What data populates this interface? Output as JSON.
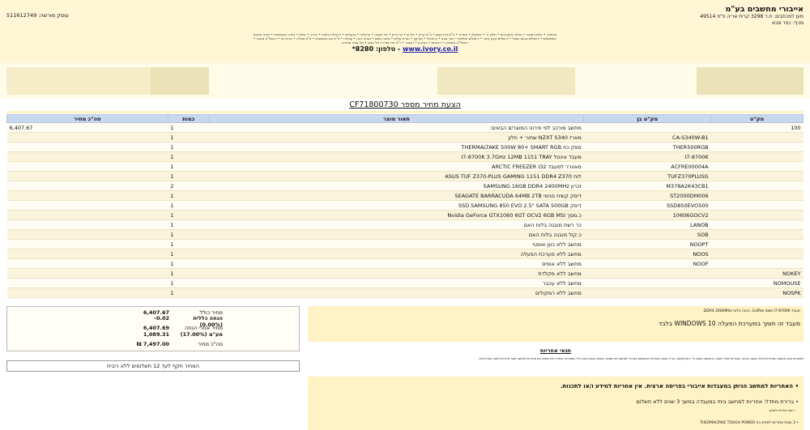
{
  "company": {
    "name": "אייבורי מחשבים בע\"מ",
    "address": "מען למכתבים: ת.ד 3298 קרית אריה פ\"ת 49514",
    "branch": "סניף: כפר סבא"
  },
  "license": "עוסק מורשה: 511612749",
  "ads_text": "סניפים: • אולם תצוגה • אולם התערוכות • חולון ה' • אשקלון • אשדוד • ב\"ש בית נעמן • ב\"ש קריון • בת ים • בני ברק • בני תקווה • הרצליה • גבעתיים • הרצליה פיתוח • חדרה • חולון • חיפה העצמאות • חיפה תנועת המשתמש • ירושלים גבעת שאול • ירושלים קניון ביתר • ירושלים תלפיות • כפר סבא • כרמיאל • מודיעין • נצרת עילית • נתניה מתם • נתניה רבה • עפולה • פ\"ת אם המושבות • פ\"ת סגולה • קרית גת • ראשל\"צ מערב • ראשל\"צ השכונה • רחובות • רמת גן • רעננה • ר\"ש הדרומית • תל אביב • תל אביב ספורט",
  "website": {
    "url": "www.ivory.co.il",
    "phone": "טלפון: 8280*"
  },
  "quote": {
    "title": "הצעת מחיר מספר CF71800730"
  },
  "table": {
    "headers": {
      "item": "מק\"ט",
      "model": "מק\"ט בן",
      "desc": "תאור מוצר",
      "qty": "כמות",
      "total": "סה\"כ מחיר"
    },
    "rows": [
      {
        "item": "100",
        "model": "",
        "desc": "מחשב מורכב לפי פירוט המוצרים הבאים:",
        "qty": "1",
        "total": "6,407.67"
      },
      {
        "item": "",
        "model": "CA-S340W-B1",
        "desc": "מארז NZXT S340 שחור + חלון",
        "qty": "1",
        "total": ""
      },
      {
        "item": "",
        "model": "THER500RGB",
        "desc": "ספק כח THERMALTAKE 500W 80+ SMART RGB",
        "qty": "1",
        "total": ""
      },
      {
        "item": "",
        "model": "I7-8700K",
        "desc": "מעבד אינטל I7-8700K 3.7GHz 12MB 1151 TRAY",
        "qty": "1",
        "total": ""
      },
      {
        "item": "",
        "model": "ACFRE00004A",
        "desc": "מאוורר למעבד ARCTIC FREEZER I32",
        "qty": "1",
        "total": ""
      },
      {
        "item": "",
        "model": "TUFZ370PLUSG",
        "desc": "לוח ASUS TUF Z370-PLUS GAMING 1151 DDR4 Z370",
        "qty": "1",
        "total": ""
      },
      {
        "item": "",
        "model": "M378A2K43CB1",
        "desc": "זכרון SAMSUNG 16GB DDR4 2400MHz",
        "qty": "2",
        "total": ""
      },
      {
        "item": "",
        "model": "ST2000DM006",
        "desc": "דיסק קשיח פנימי SEAGATE BARRACUDA 64MB 2TB",
        "qty": "1",
        "total": ""
      },
      {
        "item": "",
        "model": "SSD850EVO500",
        "desc": "דיסק SSD SAMSUNG 850 EVO 2.5\" SATA 500GB",
        "qty": "1",
        "total": ""
      },
      {
        "item": "",
        "model": "10606GOCV2",
        "desc": "כ.מסך Nvidia GeForce GTX1060 6GT OCV2 6GB MSI",
        "qty": "1",
        "total": ""
      },
      {
        "item": "",
        "model": "LANOB",
        "desc": "כר רשת מובנה בלוח האם",
        "qty": "1",
        "total": ""
      },
      {
        "item": "",
        "model": "SOB",
        "desc": "כ.קול מובנה בלוח האם",
        "qty": "1",
        "total": ""
      },
      {
        "item": "",
        "model": "NOOPT",
        "desc": "מחשב ללא כונן אופטי",
        "qty": "1",
        "total": ""
      },
      {
        "item": "",
        "model": "NOOS",
        "desc": "מחשב ללא מערכת הפעלה",
        "qty": "1",
        "total": ""
      },
      {
        "item": "",
        "model": "NOOF",
        "desc": "מחשב ללא אופיס",
        "qty": "1",
        "total": ""
      },
      {
        "item": "NOKEY",
        "model": "",
        "desc": "מחשב ללא מקלדת",
        "qty": "1",
        "total": ""
      },
      {
        "item": "NOMOUSE",
        "model": "",
        "desc": "מחשב ללא עכבר",
        "qty": "1",
        "total": ""
      },
      {
        "item": "NOSPK",
        "model": "",
        "desc": "מחשב ללא רמקולים",
        "qty": "1",
        "total": ""
      }
    ]
  },
  "totals": {
    "price_label": "מחיר כולל",
    "price": "6,407.67",
    "discount_label": "הנחה כללית (0.00%)",
    "discount": "-0.02",
    "after_label": "מחיר אחרי הנחה",
    "after": "6,407.69",
    "vat_label": "מע\"מ (17.00%)",
    "vat": "1,089.31",
    "total_label": "סה\"כ מחיר",
    "total": "₪ 7,497.00"
  },
  "payment_note": "המחיר תקף לעד 12 תשלומים ללא ריבית",
  "notes": {
    "line1": "מעבד Coffee lake I7-8700K, הכנה בלוח DDR4 2666Mhz.",
    "line2": "מעבד זה תומך במערכת הפעלה WINDOWS 10 בלבד"
  },
  "warranty": {
    "title": "תנאי אחריות",
    "text": "למוצרים בהם תקופת האחריות גדולה משנה אחת, האחריות מעל השנה הראשונה תינתן ע\"י היצרן/יבואן. סה\"כ שנות האחריות המוצעות בצירוף למחשב לפי מספר השנים הגבוה מבין כלל המוצרים. במידה ולא מופיע זמן אחריות למחשב תקף אחריות לשנה אחת בלבד.",
    "line1": "• האחריות למחשב הניתן במעבדות אייבורי בפריסה ארצית. אין אחריות למידע ו/או לתכנות.",
    "line2": "• ברירת מחדל: אחריות למחשב ביתי במעבדה במשך 3 שנים ללא תשלום",
    "line3": "• שנת אחריות לספק:",
    "line4": "• 3 שנות אחריות לספק כח THERMALTAKE TOUGH POWER"
  }
}
